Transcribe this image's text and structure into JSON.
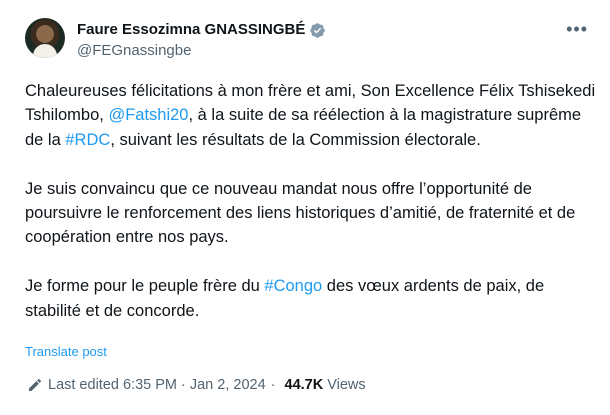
{
  "author": {
    "display_name": "Faure Essozimna GNASSINGBÉ",
    "handle": "@FEGnassingbe"
  },
  "post": {
    "p1_a": "Chaleureuses félicitations à mon frère et ami, Son Excellence Félix Tshisekedi Tshilombo, ",
    "p1_mention": "@Fatshi20",
    "p1_b": ", à la suite de sa réélection à la magistrature suprême de la ",
    "p1_hashtag": "#RDC",
    "p1_c": ", suivant les résultats de la Commission électorale.",
    "p2": "Je suis convaincu que ce nouveau mandat nous offre l’opportunité de poursuivre le renforcement des liens historiques d’amitié, de fraternité et de coopération entre nos pays.",
    "p3_a": "Je forme pour le peuple frère du ",
    "p3_hashtag": "#Congo",
    "p3_b": " des vœux ardents de paix, de stabilité et de concorde."
  },
  "translate_label": "Translate post",
  "meta": {
    "edited_label": "Last edited 6:35 PM · Jan 2, 2024",
    "separator": "·",
    "views_count": "44.7K",
    "views_label": "Views"
  },
  "icons": {
    "verified": "verified-badge-icon",
    "more": "more-options-icon",
    "edit": "pencil-icon"
  },
  "colors": {
    "link": "#1d9bf0",
    "text": "#0f1419",
    "secondary": "#536471"
  }
}
